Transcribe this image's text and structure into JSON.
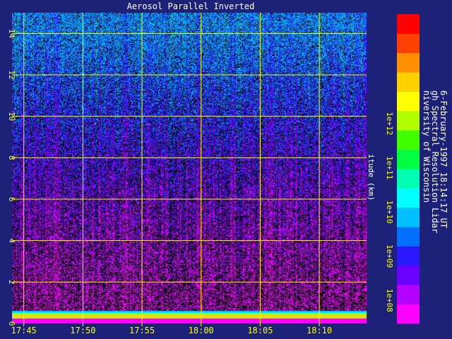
{
  "chart_data": {
    "type": "heatmap",
    "title": "Aerosol Parallel Inverted",
    "xlabel": "",
    "ylabel": "itude (km)",
    "x_ticks": [
      "17:45",
      "17:50",
      "17:55",
      "18:00",
      "18:05",
      "18:10"
    ],
    "x_range": [
      "17:44",
      "18:14"
    ],
    "y_ticks": [
      0,
      2,
      4,
      6,
      8,
      10,
      12,
      14
    ],
    "ylim": [
      0,
      15
    ],
    "grid": true,
    "colorbar": {
      "scale": "log",
      "range": [
        30000000,
        300000000000000
      ],
      "ticks": [
        "1e+08",
        "1e+09",
        "1e+10",
        "1e+11",
        "1e+12"
      ],
      "tick_values": [
        100000000,
        1000000000,
        10000000000,
        100000000000,
        1000000000000
      ],
      "colors": [
        "#ff00ff",
        "#b400ff",
        "#6a00ff",
        "#2a18ff",
        "#0070ff",
        "#00c0ff",
        "#00ffff",
        "#00ffb0",
        "#00ff40",
        "#40ff00",
        "#b0ff00",
        "#ffff00",
        "#ffd000",
        "#ff9000",
        "#ff4000",
        "#ff0000"
      ]
    },
    "annotations": [
      "niversity of Wisconsin",
      "gh Spectral Resolution Lidar",
      "6-February-1997 18:14:17 UT"
    ],
    "colors": {
      "background": "#1c2278",
      "axis_text": "#ffff00",
      "grid": "#ffff00",
      "annotation_text": "#ffffff"
    }
  }
}
